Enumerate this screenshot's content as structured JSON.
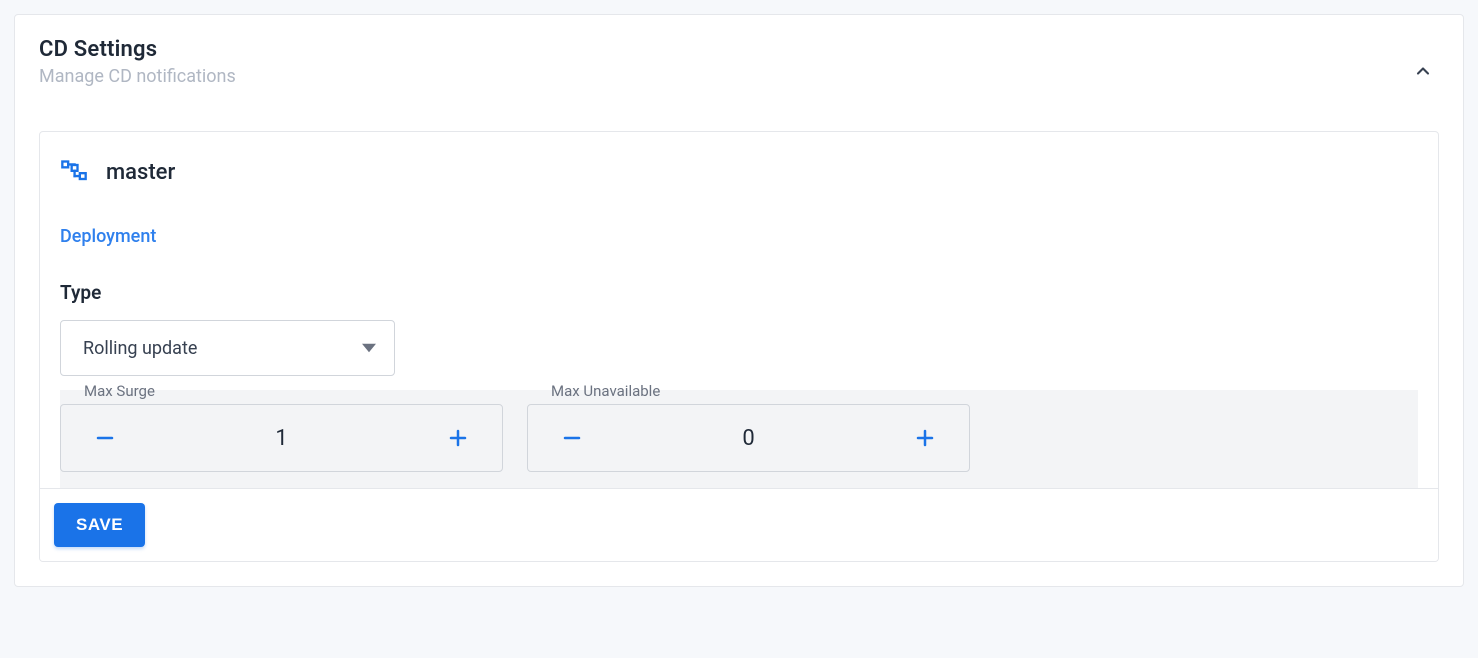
{
  "header": {
    "title": "CD Settings",
    "subtitle": "Manage CD notifications"
  },
  "branch": {
    "name": "master"
  },
  "tabs": {
    "deployment": "Deployment"
  },
  "form": {
    "type_label": "Type",
    "type_value": "Rolling update",
    "max_surge": {
      "label": "Max Surge",
      "value": "1"
    },
    "max_unavailable": {
      "label": "Max Unavailable",
      "value": "0"
    }
  },
  "actions": {
    "save": "SAVE"
  }
}
